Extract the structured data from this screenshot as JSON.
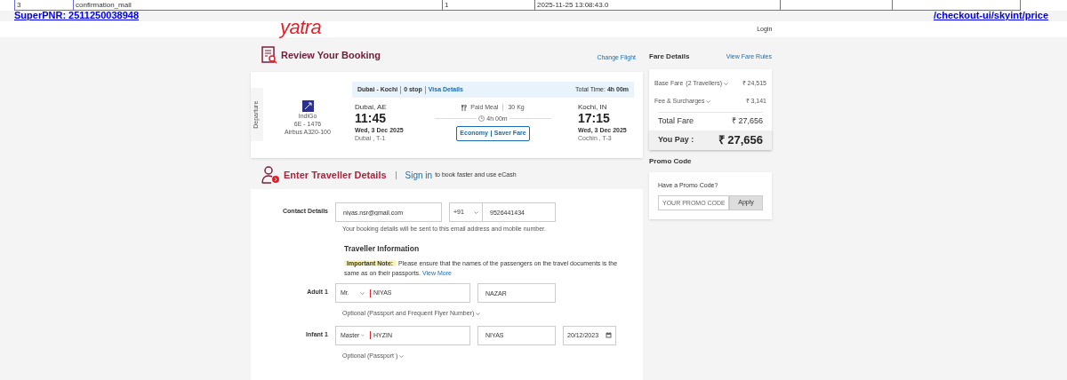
{
  "debug_table": {
    "rows": [
      {
        "cells": [
          "3",
          "confirmation_mail",
          "1",
          "2025-11-25 13:08:43.0"
        ]
      }
    ]
  },
  "top_links": {
    "super_pnr": "SuperPNR: 2511250038948",
    "path": "/checkout-ui/skyint/price"
  },
  "header": {
    "logo": "yatra",
    "login": "Login"
  },
  "review": {
    "title": "Review Your Booking",
    "change_flight": "Change Flight",
    "flight": {
      "route": "Dubai - Kochi",
      "stops": "0 stop",
      "visa": "Visa Details",
      "total_time_label": "Total Time:",
      "total_time": "4h 00m",
      "direction": "Departure",
      "airline": "IndiGo",
      "flight_no": "6E - 1476",
      "aircraft": "Airbus A320-100",
      "from": {
        "city": "Dubai, AE",
        "time": "11:45",
        "date": "Wed, 3 Dec 2025",
        "terminal": "Dubai , T-1"
      },
      "to": {
        "city": "Kochi, IN",
        "time": "17:15",
        "date": "Wed, 3 Dec 2025",
        "terminal": "Cochin , T-3"
      },
      "meal": "Paid Meal",
      "baggage": "30 Kg",
      "duration": "4h 00m",
      "cabin": "Economy",
      "fare_type": "Saver Fare"
    }
  },
  "fare": {
    "title": "Fare Details",
    "rules_link": "View Fare Rules",
    "items": [
      {
        "label": "Base Fare",
        "note": "(2 Travellers)",
        "amount": "₹ 24,515"
      },
      {
        "label": "Fee & Surcharges",
        "amount": "₹ 3,141"
      }
    ],
    "total": {
      "label": "Total Fare",
      "amount": "₹ 27,656"
    },
    "pay": {
      "label": "You Pay :",
      "amount": "₹ 27,656"
    }
  },
  "promo": {
    "title": "Promo Code",
    "question": "Have a Promo Code?",
    "placeholder": "YOUR PROMO CODE",
    "apply": "Apply"
  },
  "traveller": {
    "title": "Enter Traveller Details",
    "sign_in": "Sign in",
    "sign_in_suffix": "to book faster and use eCash",
    "contact": {
      "label": "Contact Details",
      "email": "niyas.nsr@gmail.com",
      "code": "+91",
      "phone": "9526441434",
      "note": "Your booking details will be sent to this email address and mobile number."
    },
    "info_title": "Traveller Information",
    "note_label": "Important Note:",
    "note_text": "Please ensure that the names of the passengers on the travel documents is the same as on their passports.",
    "view_more": "View More",
    "travellers": [
      {
        "label": "Adult 1",
        "title": "Mr.",
        "first": "NIYAS",
        "last": "NAZAR",
        "optional": "Optional (Passport and Frequent Flyer Number)"
      },
      {
        "label": "Infant 1",
        "title": "Master",
        "first": "HYZIN",
        "last": "NIYAS",
        "dob": "20/12/2023",
        "optional": "Optional (Passport )"
      }
    ]
  }
}
